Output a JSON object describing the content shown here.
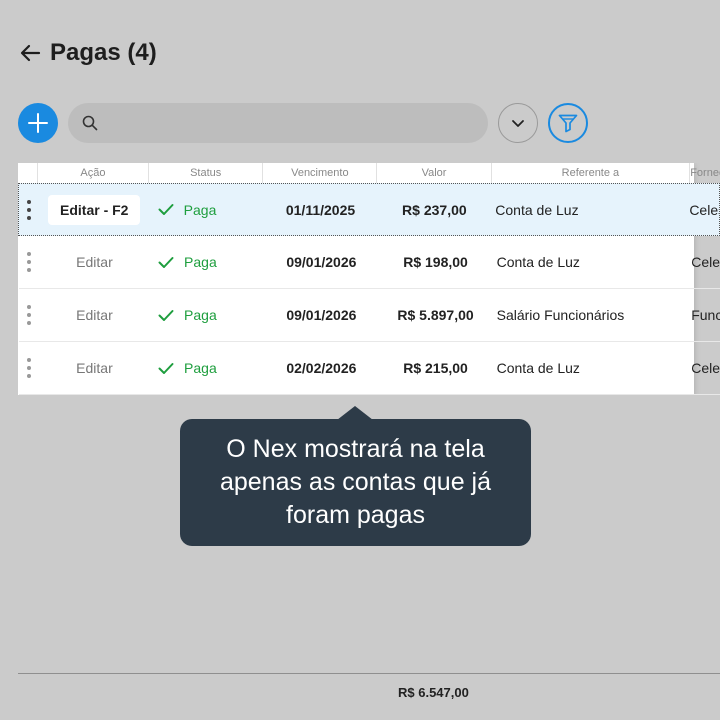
{
  "header": {
    "title": "Pagas (4)"
  },
  "search": {
    "placeholder": ""
  },
  "table": {
    "columns": [
      "Ação",
      "Status",
      "Vencimento",
      "Valor",
      "Referente a",
      "Fornecedor"
    ],
    "rows": [
      {
        "action": "Editar - F2",
        "status": "Paga",
        "due": "01/11/2025",
        "value": "R$ 237,00",
        "reference": "Conta de Luz",
        "supplier": "Celesc"
      },
      {
        "action": "Editar",
        "status": "Paga",
        "due": "09/01/2026",
        "value": "R$ 198,00",
        "reference": "Conta de Luz",
        "supplier": "Celesc"
      },
      {
        "action": "Editar",
        "status": "Paga",
        "due": "09/01/2026",
        "value": "R$ 5.897,00",
        "reference": "Salário Funcionários",
        "supplier": "Funcionários"
      },
      {
        "action": "Editar",
        "status": "Paga",
        "due": "02/02/2026",
        "value": "R$ 215,00",
        "reference": "Conta de Luz",
        "supplier": "Celesc"
      }
    ]
  },
  "tooltip": {
    "text": "O Nex mostrará na tela apenas as contas que já foram pagas"
  },
  "footer": {
    "total": "R$ 6.547,00"
  },
  "colors": {
    "accent": "#1a8ae0",
    "status_paid": "#1e9e3e",
    "tooltip_bg": "#2d3b48",
    "selected_row": "#e6f3fc"
  },
  "icons": {
    "back": "arrow-left-icon",
    "add": "plus-icon",
    "search": "search-icon",
    "dropdown": "chevron-down-icon",
    "filter": "filter-icon",
    "row_menu": "vertical-dots-icon",
    "status": "check-icon"
  }
}
